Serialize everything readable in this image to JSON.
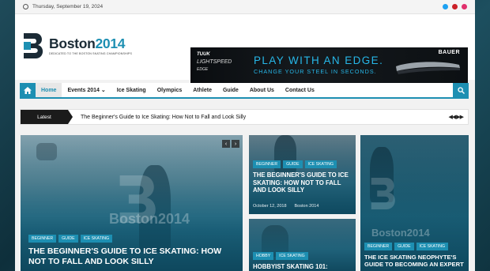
{
  "topbar": {
    "date": "Thursday, September 19, 2024",
    "social_icons": [
      "twitter-icon",
      "pinterest-icon",
      "instagram-icon"
    ]
  },
  "logo": {
    "name_word": "Boston",
    "name_num": "2014",
    "tagline": "DEDICATED TO THE BOSTON SKATING CHAMPIONSHIPS"
  },
  "banner": {
    "brand_left": "TUUK",
    "product": "LIGHTSPEED",
    "product_sub": "EDGE",
    "headline": "PLAY WITH AN EDGE.",
    "subline": "CHANGE YOUR STEEL IN SECONDS.",
    "brand_right": "BAUER"
  },
  "nav": {
    "items": [
      {
        "label": "Home",
        "active": true
      },
      {
        "label": "Events 2014 ⌄",
        "active": false
      },
      {
        "label": "Ice Skating",
        "active": false
      },
      {
        "label": "Olympics",
        "active": false
      },
      {
        "label": "Athlete",
        "active": false
      },
      {
        "label": "Guide",
        "active": false
      },
      {
        "label": "About Us",
        "active": false
      },
      {
        "label": "Contact Us",
        "active": false
      }
    ]
  },
  "ticker": {
    "label": "Latest",
    "text": "The Beginner's Guide to Ice Skating: How Not to Fall and Look Silly",
    "controls": "◀◀ ▶▶"
  },
  "cards": {
    "main": {
      "tags": [
        "BEGINNER",
        "GUIDE",
        "ICE SKATING"
      ],
      "title": "THE BEGINNER'S GUIDE TO ICE SKATING: HOW NOT TO FALL AND LOOK SILLY",
      "watermark": "Boston2014"
    },
    "top_middle": {
      "tags": [
        "BEGINNER",
        "GUIDE",
        "ICE SKATING"
      ],
      "title": "THE BEGINNER'S GUIDE TO ICE SKATING: HOW NOT TO FALL AND LOOK SILLY",
      "date": "October 12, 2018",
      "author": "Boston 2014"
    },
    "bottom_middle": {
      "tags": [
        "HOBBY",
        "ICE SKATING"
      ],
      "title": "HOBBYIST SKATING 101:"
    },
    "right": {
      "tags": [
        "BEGINNER",
        "GUIDE",
        "ICE SKATING"
      ],
      "title": "THE ICE SKATING NEOPHYTE'S GUIDE TO BECOMING AN EXPERT",
      "watermark": "Boston2014"
    }
  },
  "colors": {
    "accent": "#1d8fb2",
    "dark": "#1b1b1b"
  }
}
